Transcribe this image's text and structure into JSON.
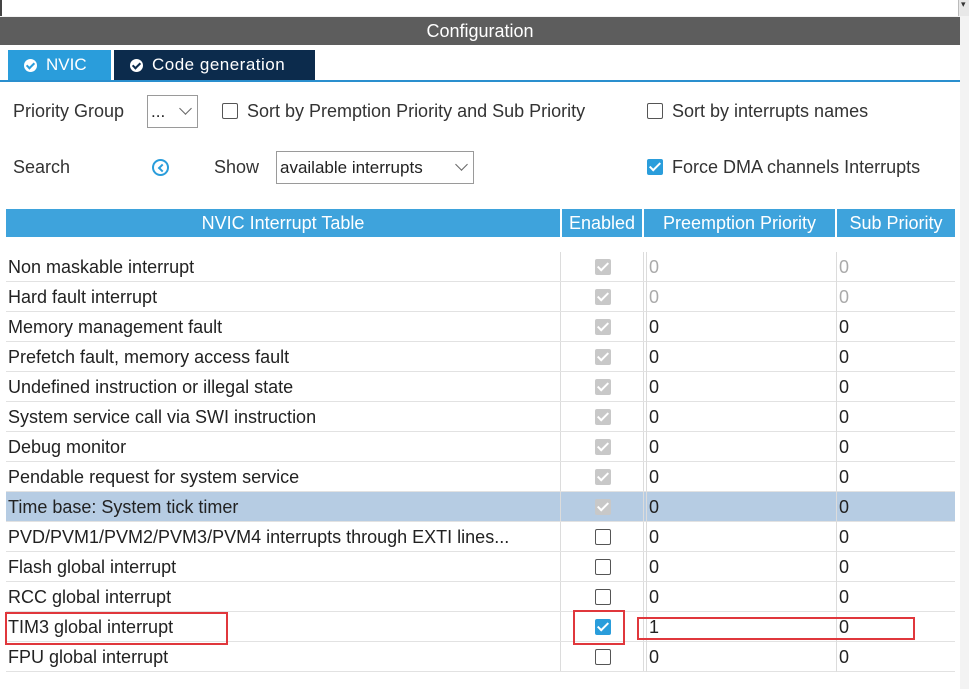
{
  "window": {
    "title": "Configuration"
  },
  "tabs": [
    {
      "label": "NVIC",
      "active": true,
      "icon": "check-circle-icon"
    },
    {
      "label": "Code generation",
      "active": false,
      "icon": "check-circle-icon"
    }
  ],
  "controls": {
    "priority_group_label": "Priority Group",
    "priority_group_value": "...",
    "sort_premption_label": "Sort by Premption Priority and Sub Priority",
    "sort_premption_checked": false,
    "sort_names_label": "Sort by interrupts names",
    "sort_names_checked": false,
    "search_label": "Search",
    "show_label": "Show",
    "show_value": "available interrupts",
    "force_dma_label": "Force DMA channels Interrupts",
    "force_dma_checked": true
  },
  "table": {
    "headers": [
      "NVIC Interrupt Table",
      "Enabled",
      "Preemption Priority",
      "Sub Priority"
    ],
    "rows": [
      {
        "name": "Non maskable interrupt",
        "enabled": true,
        "locked": true,
        "preemption": "0",
        "sub": "0",
        "gray": true
      },
      {
        "name": "Hard fault interrupt",
        "enabled": true,
        "locked": true,
        "preemption": "0",
        "sub": "0",
        "gray": true
      },
      {
        "name": "Memory management fault",
        "enabled": true,
        "locked": true,
        "preemption": "0",
        "sub": "0"
      },
      {
        "name": "Prefetch fault, memory access fault",
        "enabled": true,
        "locked": true,
        "preemption": "0",
        "sub": "0"
      },
      {
        "name": "Undefined instruction or illegal state",
        "enabled": true,
        "locked": true,
        "preemption": "0",
        "sub": "0"
      },
      {
        "name": "System service call via SWI instruction",
        "enabled": true,
        "locked": true,
        "preemption": "0",
        "sub": "0"
      },
      {
        "name": "Debug monitor",
        "enabled": true,
        "locked": true,
        "preemption": "0",
        "sub": "0"
      },
      {
        "name": "Pendable request for system service",
        "enabled": true,
        "locked": true,
        "preemption": "0",
        "sub": "0"
      },
      {
        "name": "Time base: System tick timer",
        "enabled": true,
        "locked": true,
        "preemption": "0",
        "sub": "0",
        "selected": true
      },
      {
        "name": "PVD/PVM1/PVM2/PVM3/PVM4 interrupts through EXTI lines...",
        "enabled": false,
        "preemption": "0",
        "sub": "0"
      },
      {
        "name": "Flash global interrupt",
        "enabled": false,
        "preemption": "0",
        "sub": "0"
      },
      {
        "name": "RCC global interrupt",
        "enabled": false,
        "preemption": "0",
        "sub": "0"
      },
      {
        "name": "TIM3 global interrupt",
        "enabled": true,
        "preemption": "1",
        "sub": "0",
        "highlighted": true
      },
      {
        "name": "FPU global interrupt",
        "enabled": false,
        "preemption": "0",
        "sub": "0"
      }
    ]
  },
  "colors": {
    "accent": "#2a9ddb",
    "header_dark": "#5d5d5d",
    "tab_dark": "#0c2b4c",
    "selection": "#b6cce3",
    "highlight": "#e0373c"
  }
}
